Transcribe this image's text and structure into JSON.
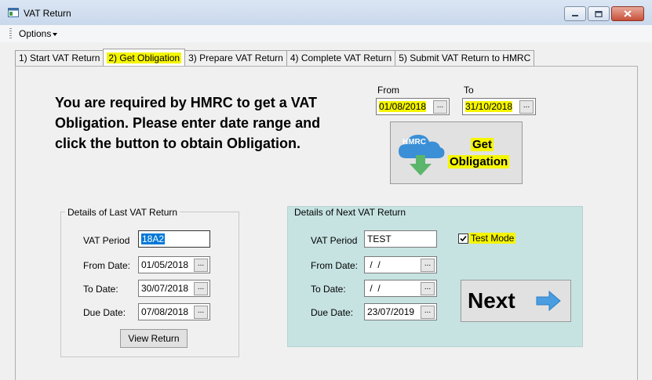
{
  "window": {
    "title": "VAT Return"
  },
  "menu": {
    "options_label": "Options"
  },
  "tabs": [
    {
      "label": "1) Start VAT Return"
    },
    {
      "label": "2) Get Obligation"
    },
    {
      "label": "3) Prepare VAT Return"
    },
    {
      "label": "4) Complete VAT Return"
    },
    {
      "label": "5) Submit VAT Return to HMRC"
    }
  ],
  "obligation": {
    "instruction": "You are required by HMRC to get a VAT Obligation. Please enter date range and click the button to obtain Obligation.",
    "from_label": "From",
    "from_value": "01/08/2018",
    "to_label": "To",
    "to_value": "31/10/2018",
    "get_button": {
      "icon_text": "HMRC",
      "line1": "Get",
      "line2": "Obligation"
    }
  },
  "last_return": {
    "legend": "Details of Last VAT Return",
    "vat_period_label": "VAT Period",
    "vat_period_value": "18A2",
    "from_label": "From Date:",
    "from_value": "01/05/2018",
    "to_label": "To Date:",
    "to_value": "30/07/2018",
    "due_label": "Due Date:",
    "due_value": "07/08/2018",
    "view_button": "View Return"
  },
  "next_return": {
    "legend": "Details of Next VAT Return",
    "vat_period_label": "VAT Period",
    "vat_period_value": "TEST",
    "test_mode_label": "Test Mode",
    "test_mode_checked": true,
    "from_label": "From Date:",
    "from_value": " /  /",
    "to_label": "To Date:",
    "to_value": " /  /",
    "due_label": "Due Date:",
    "due_value": "23/07/2019",
    "next_button": "Next"
  },
  "ellipsis": "...",
  "colors": {
    "highlight": "#f5f500",
    "next_panel_bg": "#c6e3e2",
    "hmrc_cloud": "#3a8fd6",
    "arrow_green": "#5bb56a",
    "next_arrow": "#4a9de0"
  }
}
